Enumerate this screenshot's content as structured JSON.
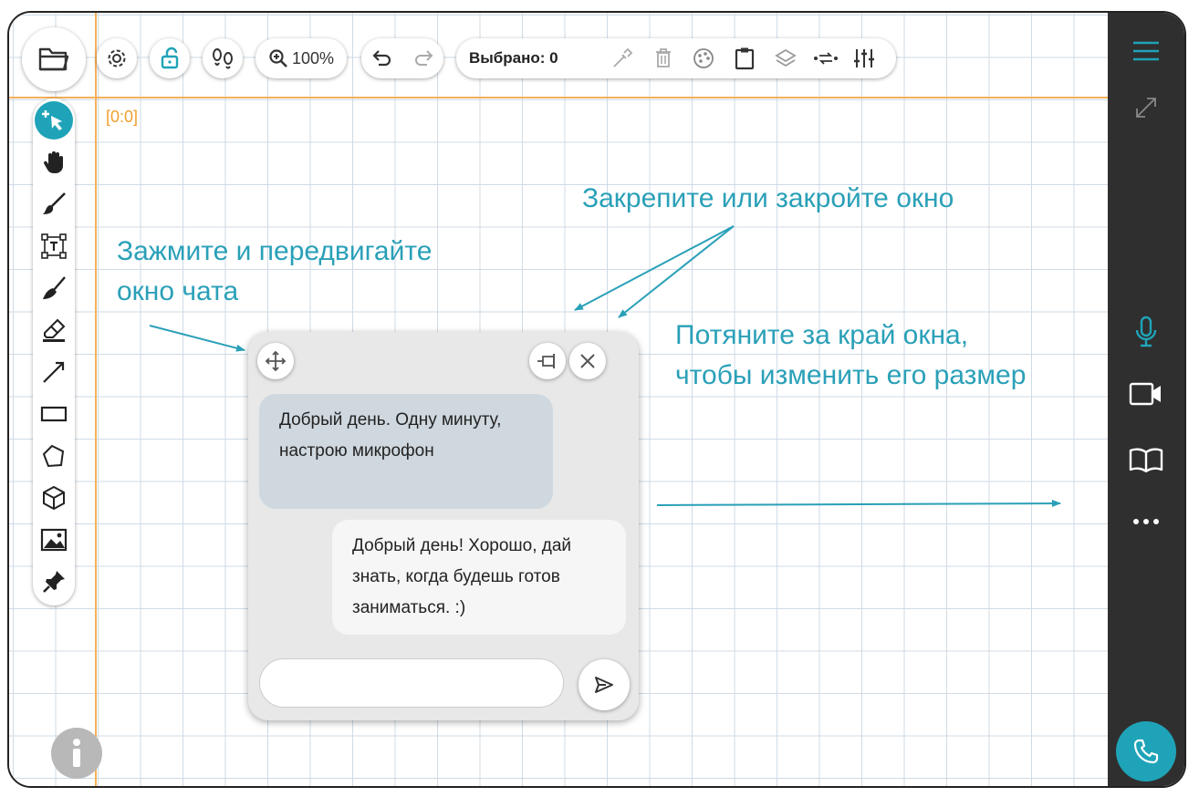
{
  "toolbar": {
    "zoom_label": "100%",
    "selected_label": "Выбрано: 0"
  },
  "canvas": {
    "origin_label": "[0:0]"
  },
  "hints": {
    "drag": [
      "Зажмите и передвигайте",
      "окно чата"
    ],
    "pin_close": "Закрепите или закройте окно",
    "resize": [
      "Потяните за край окна,",
      "чтобы изменить его размер"
    ]
  },
  "chat": {
    "messages": [
      {
        "direction": "incoming",
        "text": "Добрый день. Одну минуту, настрою микрофон"
      },
      {
        "direction": "outgoing",
        "text": "Добрый день! Хорошо, дай знать, когда будешь готов заниматься. :)"
      }
    ],
    "input_value": "",
    "input_placeholder": ""
  },
  "colors": {
    "accent": "#2aa0b8",
    "axis": "#f4b05a",
    "sidebar": "#2f2f2f",
    "call_button": "#1fa3b8"
  },
  "icons": {
    "toolbar": [
      "folder-icon",
      "gear-icon",
      "unlock-icon",
      "footprints-icon",
      "zoom-in-icon",
      "undo-icon",
      "redo-icon",
      "eyedropper-icon",
      "trash-icon",
      "palette-icon",
      "clipboard-icon",
      "layers-icon",
      "swap-icon",
      "sliders-icon"
    ],
    "tools": [
      "select-icon",
      "hand-icon",
      "brush-icon",
      "text-box-icon",
      "broom-icon",
      "eraser-icon",
      "line-icon",
      "rectangle-icon",
      "polygon-icon",
      "cube-icon",
      "image-icon",
      "pin-icon"
    ],
    "sidebar": [
      "menu-icon",
      "expand-icon",
      "microphone-icon",
      "video-camera-icon",
      "book-icon",
      "more-icon",
      "phone-icon"
    ]
  }
}
